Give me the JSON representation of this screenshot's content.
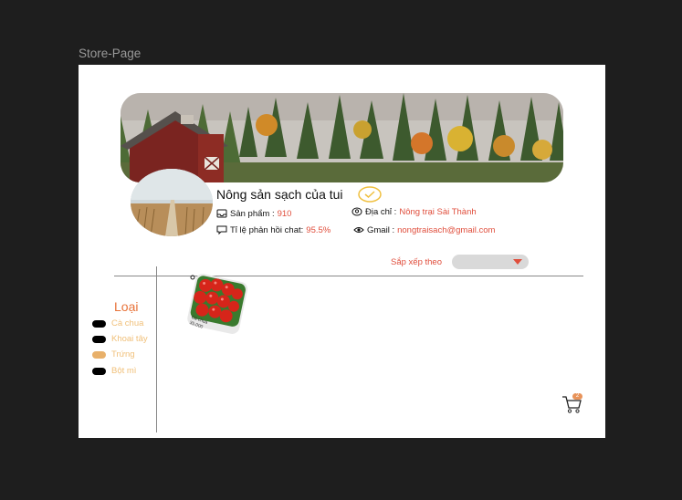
{
  "frame": {
    "title": "Store-Page"
  },
  "store": {
    "name": "Nông sản sạch của tui",
    "products_label": "Sản phẩm :",
    "products_value": "910",
    "response_label": "Tỉ lệ phản hồi chat:",
    "response_value": "95.5%",
    "address_label": "Địa chỉ :",
    "address_value": "Nông trại Sài Thành",
    "email_label": "Gmail :",
    "email_value": "nongtraisach@gmail.com"
  },
  "sort": {
    "label": "Sắp xếp theo",
    "selected": ""
  },
  "categories": {
    "title": "Loại",
    "items": [
      {
        "label": "Cà chua",
        "active": false
      },
      {
        "label": "Khoai tây",
        "active": false
      },
      {
        "label": "Trứng",
        "active": true
      },
      {
        "label": "Bột mì",
        "active": false
      }
    ]
  },
  "product": {
    "tag_name": "Cà chua",
    "tag_price": "35.000"
  },
  "cart": {
    "count": "2"
  },
  "colors": {
    "accent": "#e04e3c",
    "category": "#e8733a",
    "category_item": "#f0c07a",
    "active_pill": "#e8b06a"
  },
  "icons": [
    "verified-check-icon",
    "inbox-icon",
    "location-pin-icon",
    "chat-icon",
    "eye-icon",
    "cart-icon"
  ]
}
